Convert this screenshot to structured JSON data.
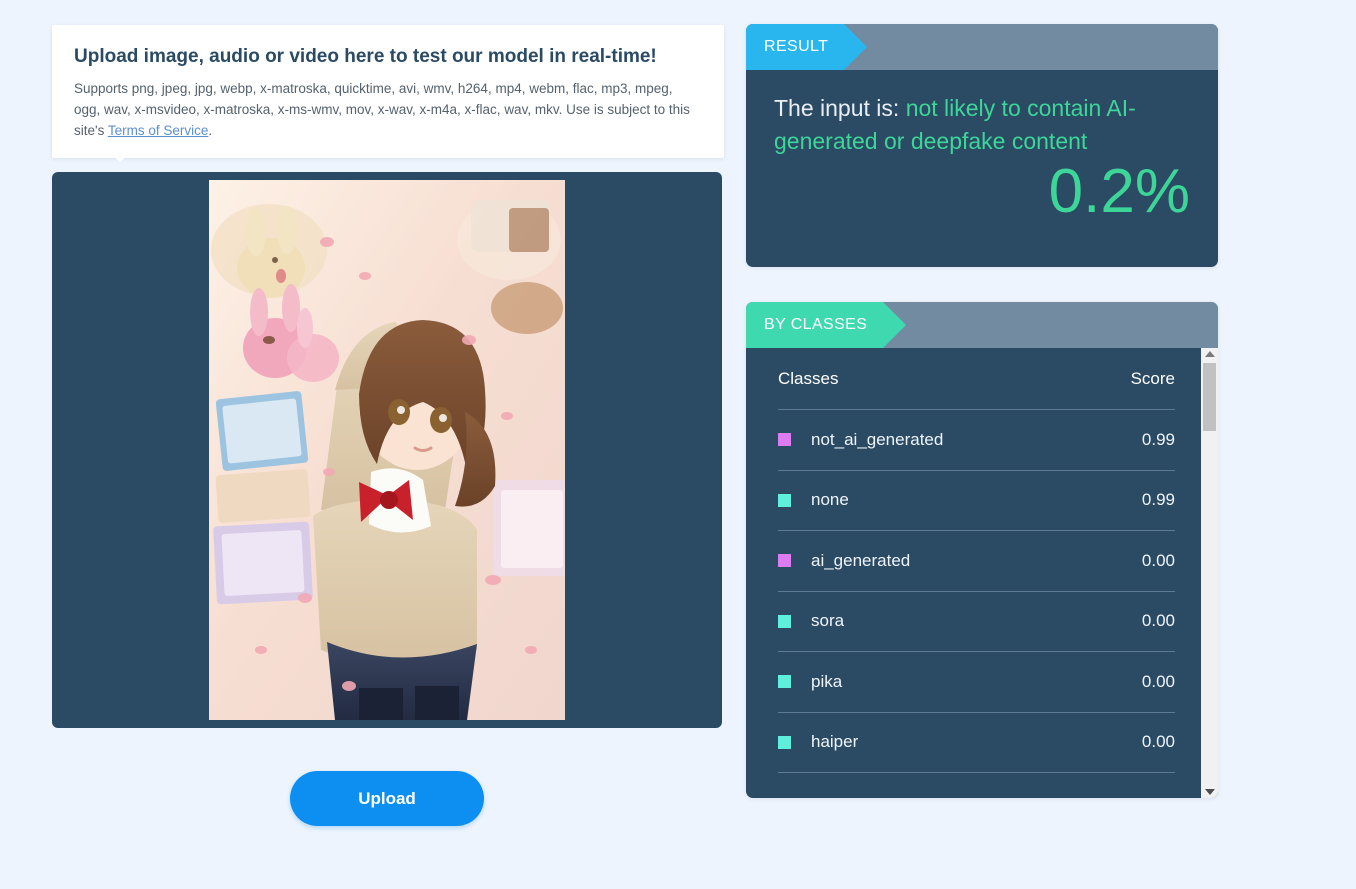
{
  "upload_tooltip": {
    "title": "Upload image, audio or video here to test our model in real-time!",
    "supports_text": "Supports png, jpeg, jpg, webp, x-matroska, quicktime, avi, wmv, h264, mp4, webm, flac, mp3, mpeg, ogg, wav, x-msvideo, x-matroska, x-ms-wmv, mov, x-wav, x-m4a, x-flac, wav, mkv. Use is subject to this site's ",
    "link_label": "Terms of Service",
    "trailing_text": "."
  },
  "preview": {
    "alt": "uploaded anime illustration of a girl lying among plush toys and books"
  },
  "upload_button": {
    "label": "Upload"
  },
  "result_card": {
    "header_label": "RESULT",
    "prefix": "The input is: ",
    "verdict": "not likely to contain AI-generated or deepfake content",
    "score": "0.2%"
  },
  "classes_card": {
    "header_label": "BY CLASSES",
    "columns": {
      "name": "Classes",
      "score": "Score"
    },
    "rows": [
      {
        "label": "not_ai_generated",
        "score": "0.99",
        "color": "#dd7cf0"
      },
      {
        "label": "none",
        "score": "0.99",
        "color": "#5ef0dd"
      },
      {
        "label": "ai_generated",
        "score": "0.00",
        "color": "#dd7cf0"
      },
      {
        "label": "sora",
        "score": "0.00",
        "color": "#5ef0dd"
      },
      {
        "label": "pika",
        "score": "0.00",
        "color": "#5ef0dd"
      },
      {
        "label": "haiper",
        "score": "0.00",
        "color": "#5ef0dd"
      }
    ]
  },
  "theme": {
    "page_bg": "#eef4fd",
    "panel_navy": "#2b4a64",
    "header_gray": "#738ba0",
    "result_tag": "#29b6ef",
    "classes_tag": "#3fd9b0",
    "accent_green": "#3dd598",
    "button_blue": "#0d8ff2",
    "link_blue": "#5b8fd4"
  }
}
